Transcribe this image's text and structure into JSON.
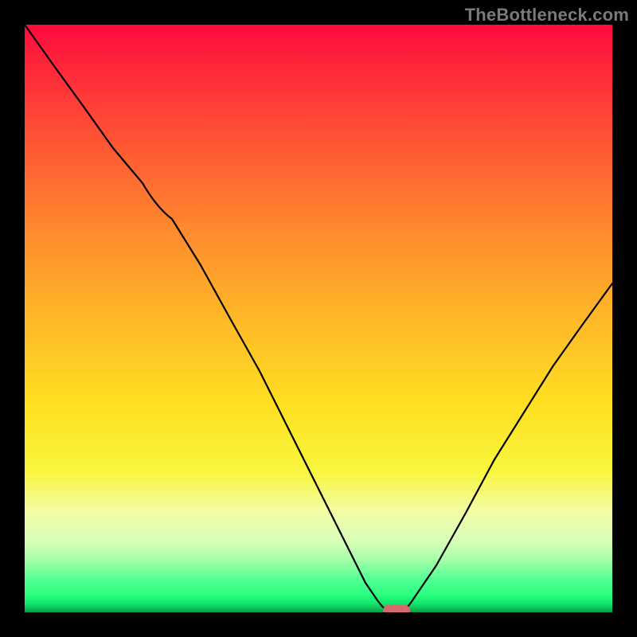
{
  "watermark": {
    "text": "TheBottleneck.com"
  },
  "colors": {
    "frame": "#000000",
    "curve": "#000000",
    "marker": "#d46a6a",
    "gradient_stops": [
      "#ff0a3c",
      "#ff2a3a",
      "#ff5534",
      "#ff8a2e",
      "#ffb828",
      "#ffe022",
      "#f8f63e",
      "#f3fca8",
      "#d7ffb8",
      "#a6ffaa",
      "#75ff9c",
      "#48ff8e",
      "#2aff80",
      "#13e76c",
      "#0ec15a",
      "#0a9a48"
    ]
  },
  "chart_data": {
    "type": "line",
    "title": "",
    "xlabel": "",
    "ylabel": "",
    "xlim": [
      0,
      100
    ],
    "ylim": [
      0,
      100
    ],
    "grid": false,
    "legend": false,
    "series": [
      {
        "name": "bottleneck-curve",
        "x": [
          0,
          5,
          10,
          15,
          20,
          25,
          30,
          35,
          40,
          45,
          50,
          55,
          58,
          60,
          62,
          64,
          66,
          70,
          75,
          80,
          85,
          90,
          95,
          100
        ],
        "y": [
          100,
          93,
          86,
          79,
          73,
          67,
          59,
          50,
          41,
          31,
          21,
          11,
          5,
          2,
          0,
          0,
          2,
          8,
          17,
          26,
          34,
          42,
          49,
          56
        ]
      }
    ],
    "annotations": [
      {
        "name": "optimal-marker",
        "x": 63,
        "y": 0,
        "shape": "pill"
      }
    ]
  }
}
